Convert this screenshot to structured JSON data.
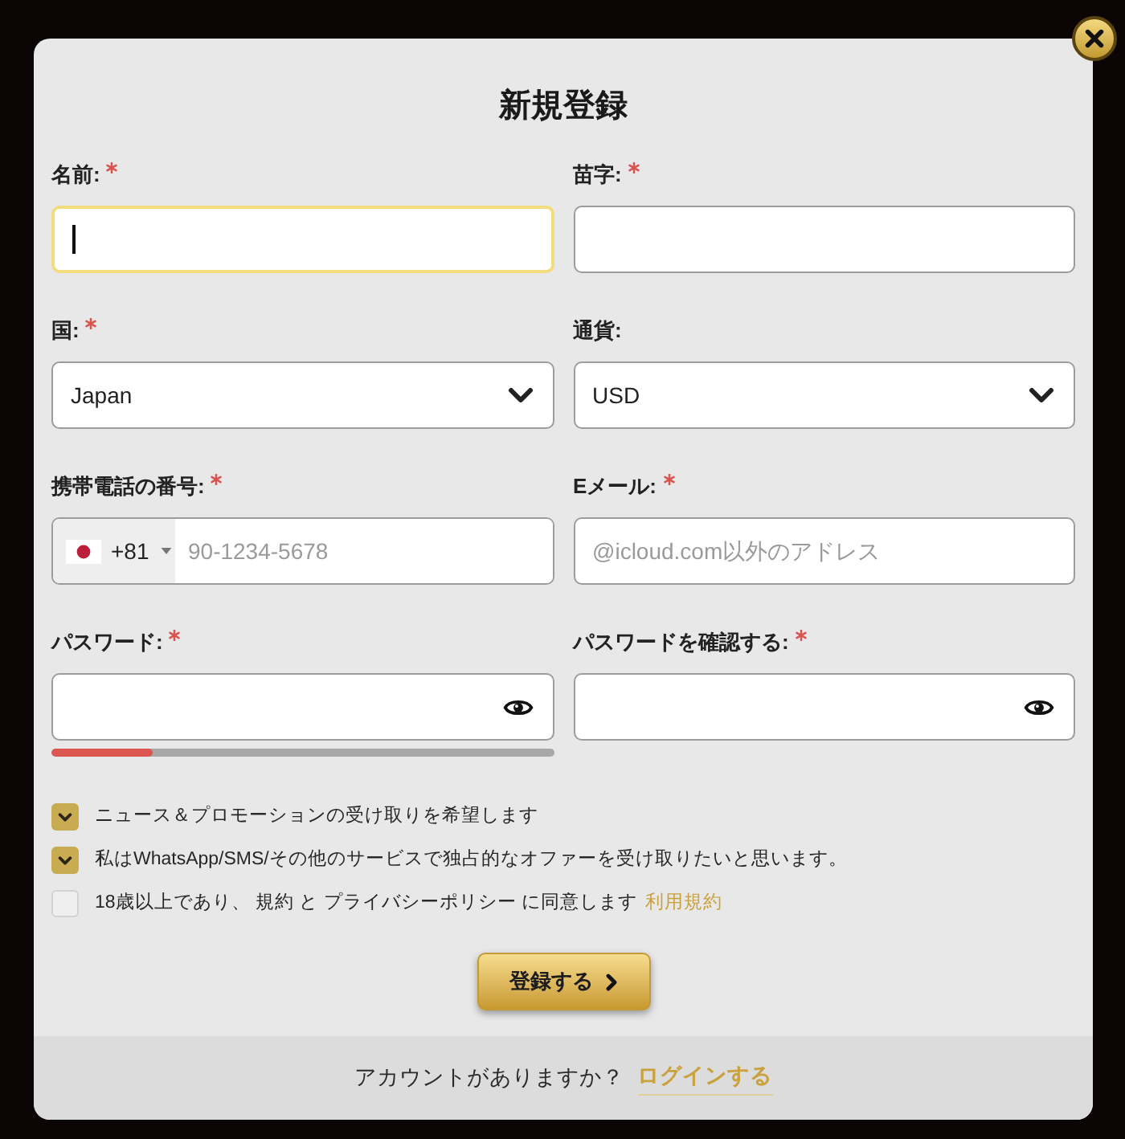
{
  "title": "新規登録",
  "fields": [
    {
      "kind": "text",
      "label": "名前:",
      "required": true,
      "focused": true
    },
    {
      "kind": "text",
      "label": "苗字:",
      "required": true,
      "focused": false
    },
    {
      "kind": "select",
      "label": "国:",
      "required": true,
      "value": "Japan"
    },
    {
      "kind": "select",
      "label": "通貨:",
      "required": false,
      "value": "USD"
    },
    {
      "kind": "phone",
      "label": "携帯電話の番号:",
      "required": true,
      "dial_code": "+81",
      "placeholder": "90-1234-5678"
    },
    {
      "kind": "text",
      "label": "Eメール:",
      "required": true,
      "focused": false,
      "placeholder": "@icloud.com以外のアドレス"
    },
    {
      "kind": "password",
      "label": "パスワード:",
      "required": true,
      "strength": {
        "level": 0.2
      }
    },
    {
      "kind": "password",
      "label": "パスワードを確認する:",
      "required": true
    }
  ],
  "checkboxes": [
    {
      "label": "ニュース＆プロモーションの受け取りを希望します",
      "checked": true
    },
    {
      "label": "私はWhatsApp/SMS/その他のサービスで独占的なオファーを受け取りたいと思います。",
      "checked": true
    },
    {
      "label": "18歳以上であり、 規約 と プライバシーポリシー に同意します",
      "link": "利用規約",
      "checked": false
    }
  ],
  "submit": {
    "label": "登録する"
  },
  "footer": {
    "text": "アカウントがありますか？",
    "link": "ログインする"
  }
}
